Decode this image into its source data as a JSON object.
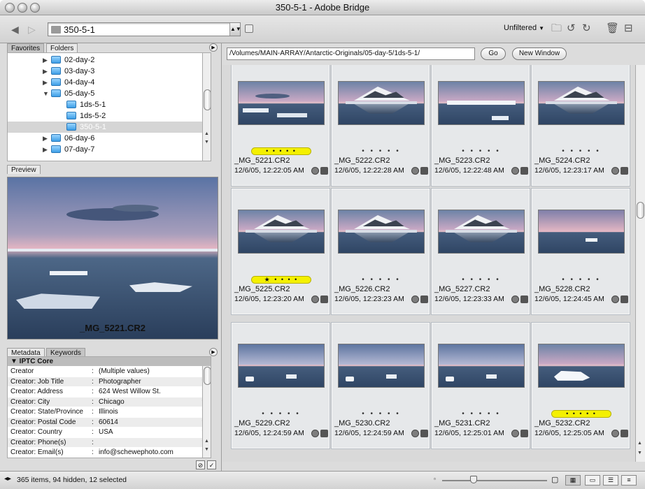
{
  "window": {
    "title": "350-5-1 - Adobe Bridge"
  },
  "toolbar": {
    "path": "350-5-1",
    "filter_label": "Unfiltered",
    "filter_arrow": "▼",
    "back_icon": "back-arrow-icon",
    "forward_icon": "forward-arrow-icon"
  },
  "left_tabs": {
    "favorites": "Favorites",
    "folders": "Folders"
  },
  "folders": [
    {
      "label": "02-day-2",
      "indent": 0,
      "tri": "▶",
      "selected": false
    },
    {
      "label": "03-day-3",
      "indent": 0,
      "tri": "▶",
      "selected": false
    },
    {
      "label": "04-day-4",
      "indent": 0,
      "tri": "▶",
      "selected": false
    },
    {
      "label": "05-day-5",
      "indent": 0,
      "tri": "▼",
      "selected": false
    },
    {
      "label": "1ds-5-1",
      "indent": 1,
      "tri": "",
      "selected": false
    },
    {
      "label": "1ds-5-2",
      "indent": 1,
      "tri": "",
      "selected": false
    },
    {
      "label": "350-5-1",
      "indent": 1,
      "tri": "",
      "selected": true
    },
    {
      "label": "06-day-6",
      "indent": 0,
      "tri": "▶",
      "selected": false
    },
    {
      "label": "07-day-7",
      "indent": 0,
      "tri": "▶",
      "selected": false
    }
  ],
  "preview": {
    "tab": "Preview",
    "filename": "_MG_5221.CR2"
  },
  "metadata": {
    "tab_metadata": "Metadata",
    "tab_keywords": "Keywords",
    "section": "▼ IPTC Core",
    "rows": [
      {
        "key": "Creator",
        "value": "(Multiple values)"
      },
      {
        "key": "Creator: Job Title",
        "value": "Photographer"
      },
      {
        "key": "Creator: Address",
        "value": "624 West Willow St."
      },
      {
        "key": "Creator: City",
        "value": "Chicago"
      },
      {
        "key": "Creator: State/Province",
        "value": "Illinois"
      },
      {
        "key": "Creator: Postal Code",
        "value": "60614"
      },
      {
        "key": "Creator: Country",
        "value": "USA"
      },
      {
        "key": "Creator: Phone(s)",
        "value": ""
      },
      {
        "key": "Creator: Email(s)",
        "value": "info@schewephoto.com"
      }
    ]
  },
  "address": {
    "path": "/Volumes/MAIN-ARRAY/Antarctic-Originals/05-day-5/1ds-5-1/",
    "go": "Go",
    "new_window": "New Window"
  },
  "thumbnails": [
    {
      "name": "_MG_5221.CR2",
      "date": "12/6/05, 12:22:05 AM",
      "label": "yellow",
      "rating": "• • • • •",
      "scene": "cloud"
    },
    {
      "name": "_MG_5222.CR2",
      "date": "12/6/05, 12:22:28 AM",
      "label": "none",
      "rating": "• • • • •",
      "scene": "mountain"
    },
    {
      "name": "_MG_5223.CR2",
      "date": "12/6/05, 12:22:48 AM",
      "label": "none",
      "rating": "• • • • •",
      "scene": "ice"
    },
    {
      "name": "_MG_5224.CR2",
      "date": "12/6/05, 12:23:17 AM",
      "label": "none",
      "rating": "• • • • •",
      "scene": "mountain"
    },
    {
      "name": "_MG_5225.CR2",
      "date": "12/6/05, 12:23:20 AM",
      "label": "yellow",
      "rating": "★ • • • •",
      "scene": "mountain"
    },
    {
      "name": "_MG_5226.CR2",
      "date": "12/6/05, 12:23:23 AM",
      "label": "none",
      "rating": "• • • • •",
      "scene": "mountain"
    },
    {
      "name": "_MG_5227.CR2",
      "date": "12/6/05, 12:23:33 AM",
      "label": "none",
      "rating": "• • • • •",
      "scene": "mountain"
    },
    {
      "name": "_MG_5228.CR2",
      "date": "12/6/05, 12:24:45 AM",
      "label": "none",
      "rating": "• • • • •",
      "scene": "pink"
    },
    {
      "name": "_MG_5229.CR2",
      "date": "12/6/05, 12:24:59 AM",
      "label": "none",
      "rating": "• • • • •",
      "scene": "water"
    },
    {
      "name": "_MG_5230.CR2",
      "date": "12/6/05, 12:24:59 AM",
      "label": "none",
      "rating": "• • • • •",
      "scene": "water"
    },
    {
      "name": "_MG_5231.CR2",
      "date": "12/6/05, 12:25:01 AM",
      "label": "none",
      "rating": "• • • • •",
      "scene": "water"
    },
    {
      "name": "_MG_5232.CR2",
      "date": "12/6/05, 12:25:05 AM",
      "label": "yellow",
      "rating": "• • • • •",
      "scene": "iceberg"
    }
  ],
  "status": {
    "text": "365 items, 94 hidden, 12 selected"
  },
  "colors": {
    "label_yellow": "#f4f000",
    "selection": "#d5d5d5",
    "folder_blue": "#3d9ee6"
  }
}
